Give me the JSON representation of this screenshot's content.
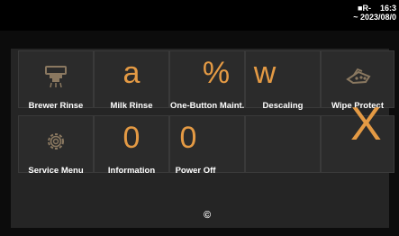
{
  "status": {
    "line1": "■R-    16:3",
    "line2": "~ 2023/08/0"
  },
  "menu": {
    "tiles": [
      {
        "label": "Brewer Rinse",
        "icon": "brewer-rinse-icon"
      },
      {
        "label": "Milk Rinse",
        "glyph": "a"
      },
      {
        "label": "One-Button Maint.",
        "glyph": "%"
      },
      {
        "label": "Descaling",
        "glyph": "w"
      },
      {
        "label": "Wipe Protect",
        "icon": "wipe-protect-icon"
      },
      {
        "label": "Service Menu",
        "icon": "gear-icon"
      },
      {
        "label": "Information",
        "glyph": "0"
      },
      {
        "label": "Power Off",
        "glyph": "0"
      }
    ]
  },
  "overlay": {
    "x_glyph": "X"
  },
  "footer": {
    "glyph": "©"
  },
  "colors": {
    "accent": "#e49a44",
    "panel": "#252525",
    "tile": "#2b2b2b"
  }
}
